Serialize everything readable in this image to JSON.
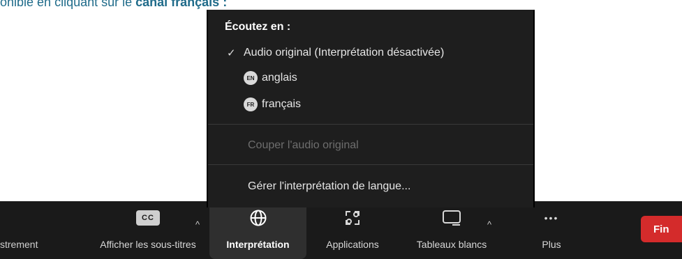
{
  "doc": {
    "prefix": "onible en cliquant sur le ",
    "bold": "canal français :"
  },
  "menu": {
    "title": "Écoutez en :",
    "original_audio": "Audio original (Interprétation désactivée)",
    "checkmark": "✓",
    "languages": [
      {
        "code": "EN",
        "label": "anglais"
      },
      {
        "code": "FR",
        "label": "français"
      }
    ],
    "mute_original": "Couper l'audio original",
    "manage": "Gérer l'interprétation de langue..."
  },
  "toolbar": {
    "items": [
      {
        "label": "strement",
        "icon": "record-icon"
      },
      {
        "label": "Afficher les sous-titres",
        "icon": "cc-icon",
        "icon_text": "CC"
      },
      {
        "label": "Interprétation",
        "icon": "globe-icon"
      },
      {
        "label": "Applications",
        "icon": "apps-icon"
      },
      {
        "label": "Tableaux blancs",
        "icon": "whiteboard-icon"
      },
      {
        "label": "Plus",
        "icon": "more-icon",
        "icon_text": "•••"
      }
    ],
    "end_label": "Fin"
  },
  "colors": {
    "toolbar_bg": "#1a1a1a",
    "menu_bg": "#1e1e1e",
    "end_red": "#d42b2b",
    "doc_text": "#1f6b8a"
  }
}
